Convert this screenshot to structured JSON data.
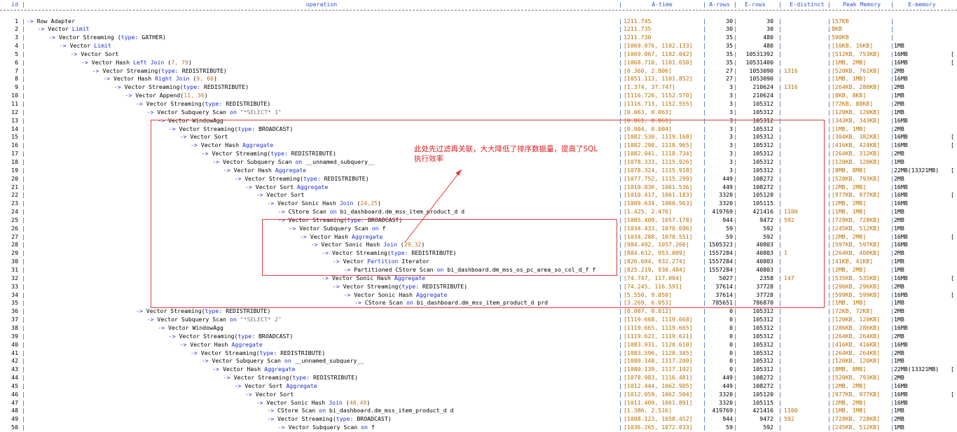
{
  "header": {
    "id": "id",
    "operation": "operation",
    "a_time": "A-time",
    "a_rows": "A-rows",
    "e_rows": "E-rows",
    "e_distinct": "E-distinct",
    "peak_memory": "Peak Memory",
    "e_memory": "E-memory"
  },
  "annotation": {
    "text": "此处先过滤再关联，大大降低了排序数据量，提高了SQL执行效率",
    "color": "#d81e1e"
  },
  "colors": {
    "keyword": "#1a2fd0",
    "number": "#b86e00",
    "box": "#e83a3a"
  },
  "rows": [
    {
      "id": "1",
      "indent": 0,
      "op": [
        {
          "t": "Row Adapter"
        }
      ],
      "at": "1211.745",
      "ar": "30",
      "er": "30",
      "ed": "",
      "pm": "157KB",
      "em": "",
      "ex": ""
    },
    {
      "id": "2",
      "indent": 1,
      "op": [
        {
          "t": "Vector "
        },
        {
          "t": "Limit",
          "k": 1
        }
      ],
      "at": "1211.735",
      "ar": "30",
      "er": "30",
      "ed": "",
      "pm": "8KB",
      "em": "",
      "ex": ""
    },
    {
      "id": "3",
      "indent": 2,
      "op": [
        {
          "t": "Vector Streaming ("
        },
        {
          "t": "type:",
          "k": 1
        },
        {
          "t": " GATHER)"
        }
      ],
      "at": "1211.730",
      "ar": "35",
      "er": "480",
      "ed": "",
      "pm": "590KB",
      "em": "",
      "ex": ""
    },
    {
      "id": "4",
      "indent": 3,
      "op": [
        {
          "t": "Vector "
        },
        {
          "t": "Limit",
          "k": 1
        }
      ],
      "at": "[1069.076, 1102.133]",
      "ar": "35",
      "er": "480",
      "ed": "",
      "pm": "[16KB, 16KB]",
      "em": "1MB",
      "ex": ""
    },
    {
      "id": "5",
      "indent": 4,
      "op": [
        {
          "t": "Vector Sort"
        }
      ],
      "at": "[1069.067, 1102.042]",
      "ar": "35",
      "er": "10531392",
      "ed": "",
      "pm": "[512KB, 753KB]",
      "em": "16MB",
      "ex": "["
    },
    {
      "id": "6",
      "indent": 5,
      "op": [
        {
          "t": "Vector Hash "
        },
        {
          "t": "Left Join",
          "k": 1
        },
        {
          "t": " ("
        },
        {
          "t": "7, 79",
          "n": 1
        },
        {
          "t": ")"
        }
      ],
      "at": "[1068.710, 1101.650]",
      "ar": "35",
      "er": "10531400",
      "ed": "",
      "pm": "[1MB, 2MB]",
      "em": "16MB",
      "ex": "["
    },
    {
      "id": "7",
      "indent": 6,
      "op": [
        {
          "t": "Vector Streaming("
        },
        {
          "t": "type:",
          "k": 1
        },
        {
          "t": " REDISTRIBUTE)"
        }
      ],
      "at": "[0.360, 2.806]",
      "ar": "27",
      "er": "1053090",
      "ed": "1316",
      "pm": "[520KB, 761KB]",
      "em": "2MB",
      "ex": ""
    },
    {
      "id": "8",
      "indent": 7,
      "op": [
        {
          "t": "Vector Hash "
        },
        {
          "t": "Right Join",
          "k": 1
        },
        {
          "t": " ("
        },
        {
          "t": "9, 60",
          "n": 1
        },
        {
          "t": ")"
        }
      ],
      "at": "[1051.113, 1101.852]",
      "ar": "27",
      "er": "1053090",
      "ed": "",
      "pm": "[1MB, 1MB]",
      "em": "16MB",
      "ex": ""
    },
    {
      "id": "9",
      "indent": 8,
      "op": [
        {
          "t": "Vector Streaming("
        },
        {
          "t": "type:",
          "k": 1
        },
        {
          "t": " REDISTRIBUTE)"
        }
      ],
      "at": "[1.374, 37.747]",
      "ar": "3",
      "er": "210624",
      "ed": "1316",
      "pm": "[264KB, 280KB]",
      "em": "2MB",
      "ex": ""
    },
    {
      "id": "10",
      "indent": 9,
      "op": [
        {
          "t": "Vector Append("
        },
        {
          "t": "11, 36",
          "n": 1
        },
        {
          "t": ")"
        }
      ],
      "at": "[1116.726, 1152.570]",
      "ar": "3",
      "er": "210624",
      "ed": "",
      "pm": "[8KB, 8KB]",
      "em": "1MB",
      "ex": ""
    },
    {
      "id": "11",
      "indent": 10,
      "op": [
        {
          "t": "Vector Streaming("
        },
        {
          "t": "type:",
          "k": 1
        },
        {
          "t": " REDISTRIBUTE)"
        }
      ],
      "at": "[1116.713, 1152.555]",
      "ar": "3",
      "er": "105312",
      "ed": "",
      "pm": "[72KB, 88KB]",
      "em": "2MB",
      "ex": ""
    },
    {
      "id": "12",
      "indent": 11,
      "op": [
        {
          "t": "Vector Subquery Scan "
        },
        {
          "t": "on",
          "k": 1
        },
        {
          "t": " "
        },
        {
          "t": "\"*SELECT* 1\"",
          "s": 1
        }
      ],
      "at": "[0.063, 0.063]",
      "ar": "3",
      "er": "105312",
      "ed": "",
      "pm": "[120KB, 120KB]",
      "em": "1MB",
      "ex": ""
    },
    {
      "id": "13",
      "indent": 12,
      "op": [
        {
          "t": "Vector WindowAgg"
        }
      ],
      "at": "[0.061, 0.061]",
      "ar": "3",
      "er": "105312",
      "ed": "",
      "pm": "[343KB, 343KB]",
      "em": "16MB",
      "ex": ""
    },
    {
      "id": "14",
      "indent": 13,
      "op": [
        {
          "t": "Vector Streaming("
        },
        {
          "t": "type:",
          "k": 1
        },
        {
          "t": " BROADCAST)"
        }
      ],
      "at": "[0.004, 0.004]",
      "ar": "3",
      "er": "105312",
      "ed": "",
      "pm": "[1MB, 1MB]",
      "em": "2MB",
      "ex": ""
    },
    {
      "id": "15",
      "indent": 14,
      "op": [
        {
          "t": "Vector Sort"
        }
      ],
      "at": "[1082.530, 1119.168]",
      "ar": "3",
      "er": "105312",
      "ed": "",
      "pm": "[304KB, 382KB]",
      "em": "16MB",
      "ex": "["
    },
    {
      "id": "16",
      "indent": 15,
      "op": [
        {
          "t": "Vector Hash "
        },
        {
          "t": "Aggregate",
          "k": 1
        }
      ],
      "at": "[1082.298, 1118.965]",
      "ar": "3",
      "er": "105312",
      "ed": "",
      "pm": "[416KB, 424KB]",
      "em": "16MB",
      "ex": "["
    },
    {
      "id": "17",
      "indent": 16,
      "op": [
        {
          "t": "Vector Streaming("
        },
        {
          "t": "type:",
          "k": 1
        },
        {
          "t": " REDISTRIBUTE)"
        }
      ],
      "at": "[1082.041, 1118.734]",
      "ar": "3",
      "er": "105312",
      "ed": "",
      "pm": "[264KB, 312KB]",
      "em": "2MB",
      "ex": ""
    },
    {
      "id": "18",
      "indent": 17,
      "op": [
        {
          "t": "Vector Subquery Scan "
        },
        {
          "t": "on",
          "k": 1
        },
        {
          "t": " __unnamed_subquery__"
        }
      ],
      "at": "[1078.333, 1115.926]",
      "ar": "3",
      "er": "105312",
      "ed": "",
      "pm": "[120KB, 120KB]",
      "em": "1MB",
      "ex": ""
    },
    {
      "id": "19",
      "indent": 18,
      "op": [
        {
          "t": "Vector Hash "
        },
        {
          "t": "Aggregate",
          "k": 1
        }
      ],
      "at": "[1078.324, 1115.918]",
      "ar": "3",
      "er": "105312",
      "ed": "",
      "pm": "[8MB, 8MB]",
      "em": "22MB(13321MB)",
      "ex": "["
    },
    {
      "id": "20",
      "indent": 19,
      "op": [
        {
          "t": "Vector Streaming("
        },
        {
          "t": "type:",
          "k": 1
        },
        {
          "t": " REDISTRIBUTE)"
        }
      ],
      "at": "[1077.752, 1115.299]",
      "ar": "449",
      "er": "108272",
      "ed": "",
      "pm": "[520KB, 793KB]",
      "em": "2MB",
      "ex": ""
    },
    {
      "id": "21",
      "indent": 20,
      "op": [
        {
          "t": "Vector Sort "
        },
        {
          "t": "Aggregate",
          "k": 1
        }
      ],
      "at": "[1010.836, 1061.536]",
      "ar": "449",
      "er": "108272",
      "ed": "",
      "pm": "[2MB, 2MB]",
      "em": "16MB",
      "ex": ""
    },
    {
      "id": "22",
      "indent": 21,
      "op": [
        {
          "t": "Vector Sort"
        }
      ],
      "at": "[1010.417, 1061.183]",
      "ar": "3320",
      "er": "105120",
      "ed": "",
      "pm": "[977KB, 977KB]",
      "em": "16MB",
      "ex": "["
    },
    {
      "id": "23",
      "indent": 22,
      "op": [
        {
          "t": "Vector Sonic Hash "
        },
        {
          "t": "Join",
          "k": 1
        },
        {
          "t": " ("
        },
        {
          "t": "24,25",
          "n": 1
        },
        {
          "t": ")"
        }
      ],
      "at": "[1009.634, 1060.563]",
      "ar": "3320",
      "er": "105115",
      "ed": "",
      "pm": "[2MB, 2MB]",
      "em": "16MB",
      "ex": ""
    },
    {
      "id": "24",
      "indent": 23,
      "op": [
        {
          "t": "CStore Scan "
        },
        {
          "t": "on",
          "k": 1
        },
        {
          "t": " bi_dashboard.dm_mss_item_product_d d"
        }
      ],
      "at": "[1.425, 2.476]",
      "ar": "419769",
      "er": "421416",
      "ed": "1100",
      "pm": "[1MB, 1MB]",
      "em": "1MB",
      "ex": ""
    },
    {
      "id": "25",
      "indent": 23,
      "op": [
        {
          "t": "Vector Streaming("
        },
        {
          "t": "type:",
          "k": 1
        },
        {
          "t": " BROADCAST)"
        }
      ],
      "at": "[1005.409, 1057.178]",
      "ar": "944",
      "er": "9472",
      "ed": "592",
      "pm": "[728KB, 728KB]",
      "em": "2MB",
      "ex": ""
    },
    {
      "id": "26",
      "indent": 24,
      "op": [
        {
          "t": "Vector Subquery Scan "
        },
        {
          "t": "on",
          "k": 1
        },
        {
          "t": " f"
        }
      ],
      "at": "[1034.433, 1070.696]",
      "ar": "59",
      "er": "592",
      "ed": "",
      "pm": "[245KB, 512KB]",
      "em": "1MB",
      "ex": ""
    },
    {
      "id": "27",
      "indent": 25,
      "op": [
        {
          "t": "Vector Hash "
        },
        {
          "t": "Aggregate",
          "k": 1
        }
      ],
      "at": "[1034.288, 1070.551]",
      "ar": "59",
      "er": "592",
      "ed": "",
      "pm": "[2MB, 2MB]",
      "em": "16MB",
      "ex": "["
    },
    {
      "id": "28",
      "indent": 26,
      "op": [
        {
          "t": "Vector Sonic Hash "
        },
        {
          "t": "Join",
          "k": 1
        },
        {
          "t": " ("
        },
        {
          "t": "29,32",
          "n": 1
        },
        {
          "t": ")"
        }
      ],
      "at": "[984.492, 1057.266]",
      "ar": "1505323",
      "er": "40803",
      "ed": "",
      "pm": "[597KB, 597KB]",
      "em": "16MB",
      "ex": ""
    },
    {
      "id": "29",
      "indent": 27,
      "op": [
        {
          "t": "Vector Streaming("
        },
        {
          "t": "type:",
          "k": 1
        },
        {
          "t": " REDISTRIBUTE)"
        }
      ],
      "at": "[884.612, 953.009]",
      "ar": "1557284",
      "er": "40803",
      "ed": "1",
      "pm": "[264KB, 400KB]",
      "em": "2MB",
      "ex": ""
    },
    {
      "id": "30",
      "indent": 28,
      "op": [
        {
          "t": "Vector "
        },
        {
          "t": "Partition",
          "k": 1
        },
        {
          "t": " Iterator"
        }
      ],
      "at": "[826.604, 932.274]",
      "ar": "1557284",
      "er": "40803",
      "ed": "",
      "pm": "[41KB, 41KB]",
      "em": "1MB",
      "ex": ""
    },
    {
      "id": "31",
      "indent": 29,
      "op": [
        {
          "t": "Partitioned CStore Scan "
        },
        {
          "t": "on",
          "k": 1
        },
        {
          "t": " bi_dashboard.dm_mss_os_pc_area_so_col_d_f f"
        }
      ],
      "at": "[825.219, 930.484]",
      "ar": "1557284",
      "er": "40803",
      "ed": "",
      "pm": "[2MB, 2MB]",
      "em": "1MB",
      "ex": ""
    },
    {
      "id": "32",
      "indent": 27,
      "op": [
        {
          "t": "Vector Sonic Hash "
        },
        {
          "t": "Aggregate",
          "k": 1
        }
      ],
      "at": "[74.747, 117.004]",
      "ar": "5027",
      "er": "2358",
      "ed": "147",
      "pm": "[535KB, 535KB]",
      "em": "16MB",
      "ex": "["
    },
    {
      "id": "33",
      "indent": 28,
      "op": [
        {
          "t": "Vector Streaming("
        },
        {
          "t": "type:",
          "k": 1
        },
        {
          "t": " REDISTRIBUTE)"
        }
      ],
      "at": "[74.245, 116.591]",
      "ar": "37614",
      "er": "37728",
      "ed": "",
      "pm": "[296KB, 296KB]",
      "em": "2MB",
      "ex": ""
    },
    {
      "id": "34",
      "indent": 29,
      "op": [
        {
          "t": "Vector Sonic Hash "
        },
        {
          "t": "Aggregate",
          "k": 1
        }
      ],
      "at": "[5.550, 9.850]",
      "ar": "37614",
      "er": "37728",
      "ed": "",
      "pm": "[599KB, 599KB]",
      "em": "16MB",
      "ex": "["
    },
    {
      "id": "35",
      "indent": 30,
      "op": [
        {
          "t": "CStore Scan "
        },
        {
          "t": "on",
          "k": 1
        },
        {
          "t": " bi_dashboard.dm_mss_item_product_d prd"
        }
      ],
      "at": "[3.269, 6.053]",
      "ar": "785651",
      "er": "786870",
      "ed": "",
      "pm": "[1MB, 1MB]",
      "em": "1MB",
      "ex": ""
    },
    {
      "id": "36",
      "indent": 10,
      "op": [
        {
          "t": "Vector Streaming("
        },
        {
          "t": "type:",
          "k": 1
        },
        {
          "t": " REDISTRIBUTE)"
        }
      ],
      "at": "[0.007, 0.012]",
      "ar": "0",
      "er": "105312",
      "ed": "",
      "pm": "[72KB, 72KB]",
      "em": "2MB",
      "ex": ""
    },
    {
      "id": "37",
      "indent": 11,
      "op": [
        {
          "t": "Vector Subquery Scan "
        },
        {
          "t": "on",
          "k": 1
        },
        {
          "t": " "
        },
        {
          "t": "\"*SELECT* 2\"",
          "s": 1
        }
      ],
      "at": "[1119.668, 1119.668]",
      "ar": "0",
      "er": "105312",
      "ed": "",
      "pm": "[120KB, 120KB]",
      "em": "1MB",
      "ex": ""
    },
    {
      "id": "38",
      "indent": 12,
      "op": [
        {
          "t": "Vector WindowAgg"
        }
      ],
      "at": "[1119.665, 1119.665]",
      "ar": "0",
      "er": "105312",
      "ed": "",
      "pm": "[286KB, 286KB]",
      "em": "16MB",
      "ex": ""
    },
    {
      "id": "39",
      "indent": 13,
      "op": [
        {
          "t": "Vector Streaming("
        },
        {
          "t": "type:",
          "k": 1
        },
        {
          "t": " BROADCAST)"
        }
      ],
      "at": "[1119.621, 1119.621]",
      "ar": "0",
      "er": "105312",
      "ed": "",
      "pm": "[264KB, 264KB]",
      "em": "2MB",
      "ex": ""
    },
    {
      "id": "40",
      "indent": 14,
      "op": [
        {
          "t": "Vector Hash "
        },
        {
          "t": "Aggregate",
          "k": 1
        }
      ],
      "at": "[1083.931, 1120.610]",
      "ar": "0",
      "er": "105312",
      "ed": "",
      "pm": "[416KB, 416KB]",
      "em": "16MB",
      "ex": ""
    },
    {
      "id": "41",
      "indent": 15,
      "op": [
        {
          "t": "Vector Streaming("
        },
        {
          "t": "type:",
          "k": 1
        },
        {
          "t": " REDISTRIBUTE)"
        }
      ],
      "at": "[1083.596, 1120.345]",
      "ar": "0",
      "er": "105312",
      "ed": "",
      "pm": "[264KB, 264KB]",
      "em": "2MB",
      "ex": ""
    },
    {
      "id": "42",
      "indent": 16,
      "op": [
        {
          "t": "Vector Subquery Scan "
        },
        {
          "t": "on",
          "k": 1
        },
        {
          "t": " __unnamed_subquery__"
        }
      ],
      "at": "[1080.148, 1117.200]",
      "ar": "0",
      "er": "105312",
      "ed": "",
      "pm": "[120KB, 120KB]",
      "em": "1MB",
      "ex": ""
    },
    {
      "id": "43",
      "indent": 17,
      "op": [
        {
          "t": "Vector Hash "
        },
        {
          "t": "Aggregate",
          "k": 1
        }
      ],
      "at": "[1080.139, 1117.192]",
      "ar": "0",
      "er": "105312",
      "ed": "",
      "pm": "[8MB, 8MB]",
      "em": "22MB(13321MB)",
      "ex": "["
    },
    {
      "id": "44",
      "indent": 18,
      "op": [
        {
          "t": "Vector Streaming("
        },
        {
          "t": "type:",
          "k": 1
        },
        {
          "t": " REDISTRIBUTE)"
        }
      ],
      "at": "[1078.983, 1116.481]",
      "ar": "449",
      "er": "108272",
      "ed": "",
      "pm": "[520KB, 793KB]",
      "em": "2MB",
      "ex": ""
    },
    {
      "id": "45",
      "indent": 19,
      "op": [
        {
          "t": "Vector Sort "
        },
        {
          "t": "Aggregate",
          "k": 1
        }
      ],
      "at": "[1012.444, 1062.905]",
      "ar": "449",
      "er": "108272",
      "ed": "",
      "pm": "[2MB, 2MB]",
      "em": "16MB",
      "ex": ""
    },
    {
      "id": "46",
      "indent": 20,
      "op": [
        {
          "t": "Vector Sort"
        }
      ],
      "at": "[1012.059, 1062.504]",
      "ar": "3320",
      "er": "105120",
      "ed": "",
      "pm": "[977KB, 977KB]",
      "em": "16MB",
      "ex": "["
    },
    {
      "id": "47",
      "indent": 21,
      "op": [
        {
          "t": "Vector Sonic Hash "
        },
        {
          "t": "Join",
          "k": 1
        },
        {
          "t": " ("
        },
        {
          "t": "48,49",
          "n": 1
        },
        {
          "t": ")"
        }
      ],
      "at": "[1011.409, 1061.891]",
      "ar": "3320",
      "er": "105115",
      "ed": "",
      "pm": "[2MB, 2MB]",
      "em": "16MB",
      "ex": ""
    },
    {
      "id": "48",
      "indent": 22,
      "op": [
        {
          "t": "CStore Scan "
        },
        {
          "t": "on",
          "k": 1
        },
        {
          "t": " bi_dashboard.dm_mss_item_product_d d"
        }
      ],
      "at": "[1.386, 2.516]",
      "ar": "419769",
      "er": "421416",
      "ed": "1100",
      "pm": "[1MB, 1MB]",
      "em": "1MB",
      "ex": ""
    },
    {
      "id": "49",
      "indent": 22,
      "op": [
        {
          "t": "Vector Streaming("
        },
        {
          "t": "type:",
          "k": 1
        },
        {
          "t": " BROADCAST)"
        }
      ],
      "at": "[1008.123, 1058.452]",
      "ar": "944",
      "er": "9472",
      "ed": "592",
      "pm": "[728KB, 728KB]",
      "em": "2MB",
      "ex": ""
    },
    {
      "id": "50",
      "indent": 23,
      "op": [
        {
          "t": "Vector Subquery Scan "
        },
        {
          "t": "on",
          "k": 1
        },
        {
          "t": " f"
        }
      ],
      "at": "[1036.265, 1072.033]",
      "ar": "59",
      "er": "592",
      "ed": "",
      "pm": "[245KB, 512KB]",
      "em": "1MB",
      "ex": ""
    }
  ]
}
